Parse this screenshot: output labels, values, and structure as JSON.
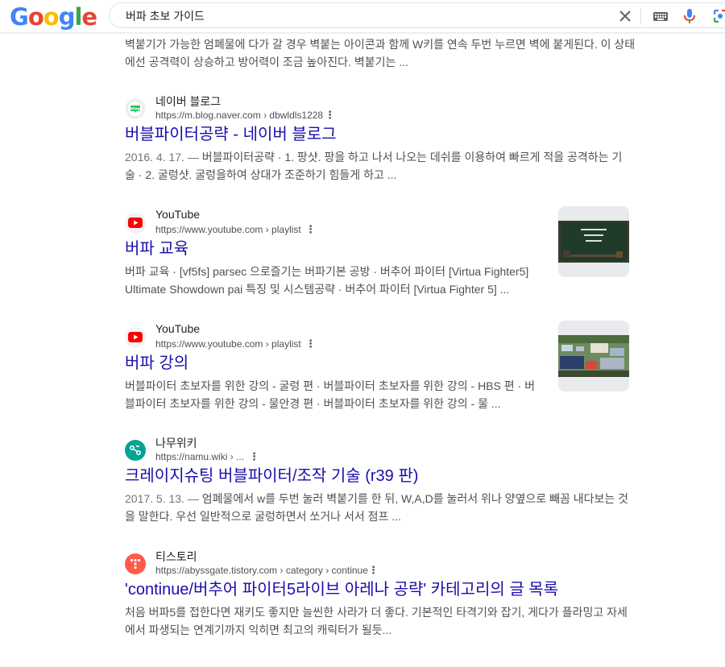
{
  "header": {
    "logo_letters": [
      "G",
      "o",
      "o",
      "g",
      "l",
      "e"
    ],
    "logo_colors": [
      "#4285F4",
      "#EA4335",
      "#FBBC05",
      "#4285F4",
      "#34A853",
      "#EA4335"
    ],
    "search_query": "버파 초보 가이드",
    "icons": [
      "clear-icon",
      "keyboard-icon",
      "mic-icon",
      "lens-icon"
    ]
  },
  "top_snippet": "벽붙기가 가능한 엄폐물에 다가 갈 경우 벽붙는 아이콘과 함께 W키를 연속 두번 누르면 벽에 붙게된다. 이 상태에선 공격력이 상승하고 방어력이 조금 높아진다. 벽붙기는 ...",
  "results": [
    {
      "site_name": "네이버 블로그",
      "url": "https://m.blog.naver.com › dbwldls1228",
      "favicon": "naver-blog-icon",
      "favicon_label": "blog",
      "title": "버블파이터공략 - 네이버 블로그",
      "date": "2016. 4. 17. — ",
      "snippet": "버블파이터공략 · 1. 팡샷. 팡을 하고 나서 나오는 데쉬를 이용하여 빠르게 적을 공격하는 기술 · 2. 굴렁샷. 굴렁을하여 상대가 조준하기 힘들게 하고 ..."
    },
    {
      "site_name": "YouTube",
      "url": "https://www.youtube.com › playlist",
      "favicon": "youtube-icon",
      "title": "버파 교육",
      "date": "",
      "snippet": "버파 교육 · [vf5fs] parsec 으로즐기는 버파기본 공방 · 버추어 파이터 [Virtua Fighter5] Ultimate Showdown pai 특징 및 시스템공략 · 버추어 파이터 [Virtua Fighter 5] ...",
      "thumbnail": "video-thumbnail-chalkboard"
    },
    {
      "site_name": "YouTube",
      "url": "https://www.youtube.com › playlist",
      "favicon": "youtube-icon",
      "title": "버파 강의",
      "date": "",
      "snippet": "버블파이터 초보자를 위한 강의 - 굴렁 편 · 버블파이터 초보자를 위한 강의 - HBS 편 · 버블파이터 초보자를 위한 강의 - 물안경 편 · 버블파이터 초보자를 위한 강의 - 물 ...",
      "thumbnail": "video-thumbnail-game"
    },
    {
      "site_name": "나무위키",
      "url": "https://namu.wiki › ...",
      "favicon": "namu-wiki-icon",
      "title": "크레이지슈팅 버블파이터/조작 기술 (r39 판)",
      "date": "2017. 5. 13. — ",
      "snippet": "엄폐물에서 w를 두번 눌러 벽붙기를 한 뒤, W,A,D를 눌러서 위나 양옆으로 빼꼼 내다보는 것을 말한다. 우선 일반적으로 굴렁하면서 쏘거나 서서 점프 ..."
    },
    {
      "site_name": "티스토리",
      "url": "https://abyssgate.tistory.com › category › continue",
      "favicon": "tistory-icon",
      "title": "'continue/버추어 파이터5라이브 아레나 공략' 카테고리의 글 목록",
      "date": "",
      "snippet": "처음 버파5를 접한다면 재키도 좋지만 늘씬한 사라가 더 좋다. 기본적인 타격기와 잡기, 게다가 플라밍고 자세에서 파생되는 연계기까지 익히면 최고의 캐릭터가 될듯..."
    }
  ]
}
